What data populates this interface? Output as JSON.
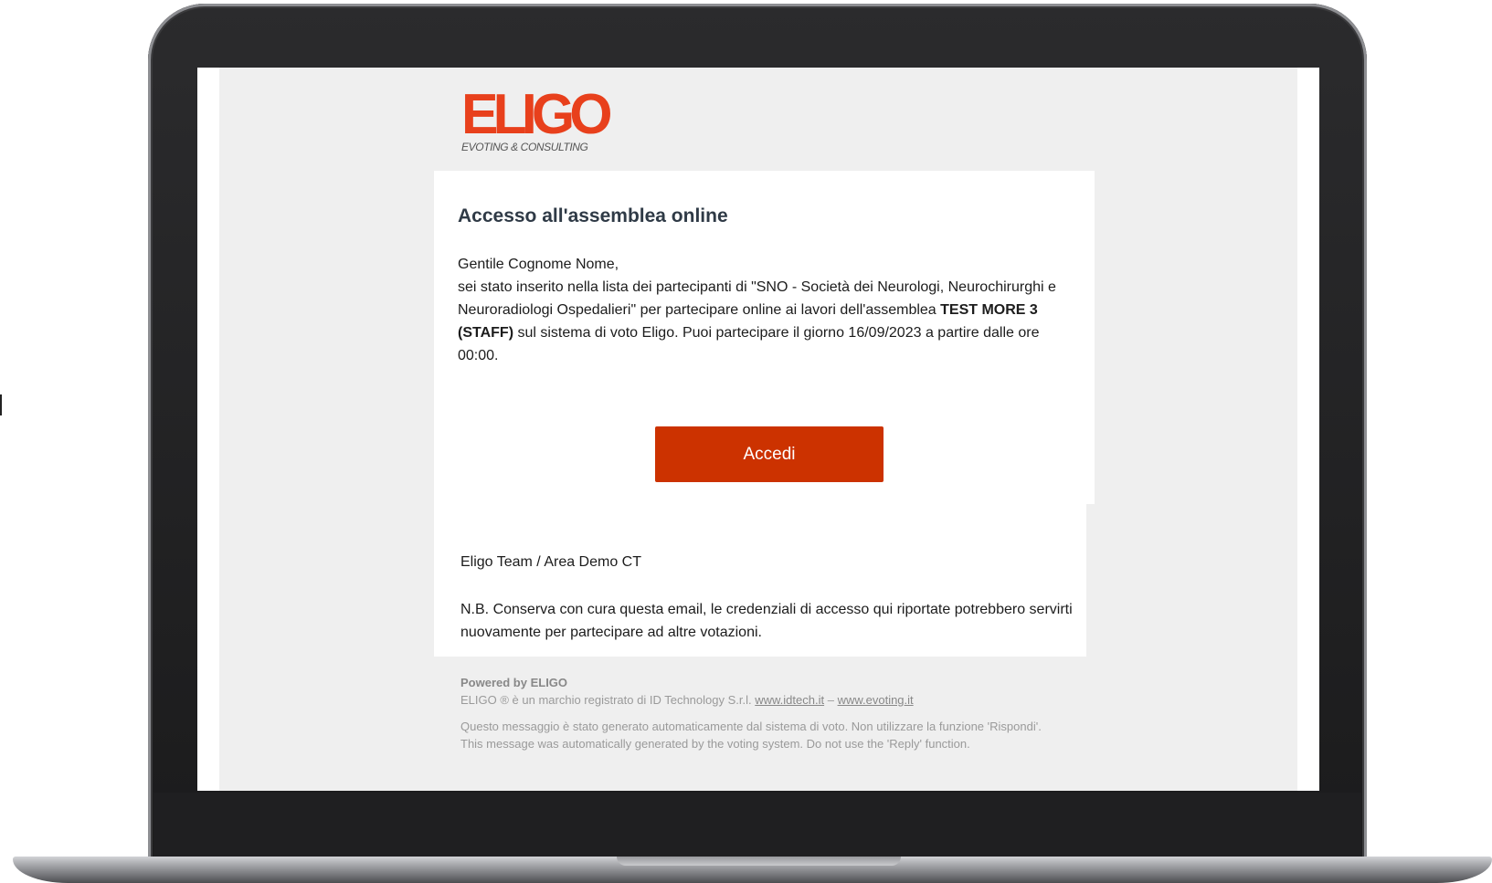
{
  "brand": {
    "logo_word": "ELIGO",
    "logo_tagline": "EVOTING & CONSULTING",
    "accent_color": "#cc3200",
    "logo_color": "#e8401c"
  },
  "email": {
    "title": "Accesso all'assemblea online",
    "greeting": "Gentile Cognome Nome,",
    "body_before": "sei stato inserito nella lista dei partecipanti di \"SNO - Società dei Neurologi, Neurochirurghi e Neuroradiologi Ospedalieri\" per partecipare online ai lavori dell'assemblea ",
    "assembly_name": "TEST MORE 3 (STAFF)",
    "body_after": " sul sistema di voto Eligo. Puoi partecipare il giorno 16/09/2023 a partire dalle ore 00:00.",
    "button_label": "Accedi",
    "signature": "Eligo Team / Area Demo CT",
    "note": "N.B. Conserva con cura questa email, le credenziali di accesso qui riportate potrebbero servirti nuovamente per partecipare ad altre votazioni."
  },
  "footer": {
    "powered_by": "Powered by ELIGO",
    "trademark_text": "ELIGO ® è un marchio registrato di ID Technology S.r.l. ",
    "link_idtech": "www.idtech.it",
    "separator": " – ",
    "link_evoting": "www.evoting.it",
    "disclaimer": "Questo messaggio è stato generato automaticamente dal sistema di voto. Non utilizzare la funzione 'Rispondi'. This message was automatically generated by the voting system. Do not use the 'Reply' function."
  }
}
